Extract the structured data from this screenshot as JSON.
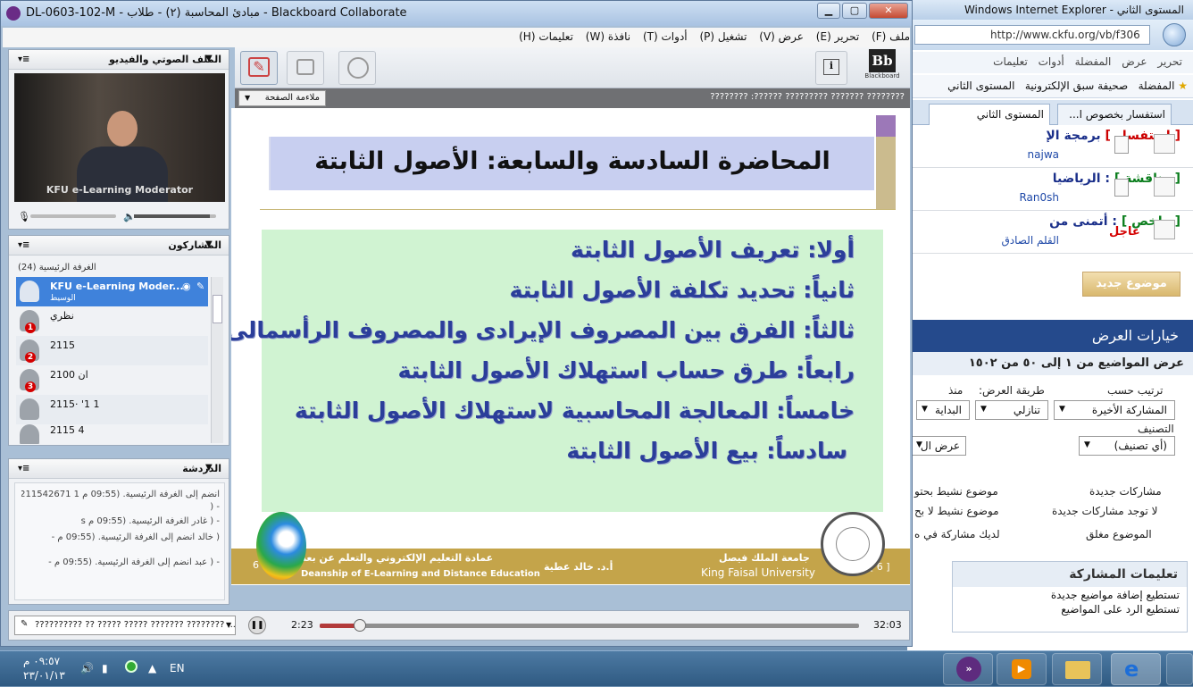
{
  "ie": {
    "title": "المستوى الثاني - Windows Internet Explorer",
    "url": "http://www.ckfu.org/vb/f306",
    "menu": [
      "تحرير",
      "عرض",
      "المفضلة",
      "أدوات",
      "تعليمات"
    ],
    "favorites": [
      "المفضلة",
      "صحيفة سبق الإلكترونية",
      "المستوى الثاني"
    ],
    "tabs": [
      "استفسار بخصوص ا...",
      "المستوى الثاني"
    ],
    "topics": [
      {
        "tag": "[ استفسار ]",
        "title": "برمجة الإ",
        "author": "najwa"
      },
      {
        "tag": "[ مناقشة ]",
        "title": ": الرياضيا",
        "author": "Ran0sh"
      },
      {
        "tag": "[ ملخص ]",
        "title": ": أتمنى من",
        "author": "القلم الصادق",
        "urgent": "عاجل"
      }
    ],
    "new_topic": "موضوع جديد",
    "display_options_title": "خيارات العرض",
    "range_text": "عرض المواضيع من ١ إلى ٥٠ من ١٥٠٢",
    "sort_by_label": "ترتيب حسب",
    "sort_method_label": "طريقة العرض:",
    "since_label": "منذ",
    "sort_by_value": "المشاركة الأخيرة",
    "sort_method_value": "تنازلي",
    "since_value": "البداية",
    "category_label": "التصنيف",
    "category_value": "(أي تصنيف)",
    "show_button": "عرض ال",
    "legend": [
      "مشاركات جديدة",
      "موضوع نشيط بحتو",
      "لا توجد مشاركات جديدة",
      "موضوع نشيط لا بح",
      "الموضوع مغلق",
      "لديك مشاركة في ه"
    ],
    "rules_title": "تعليمات المشاركة",
    "rules": [
      "تستطيع إضافة مواضيع جديدة",
      "تستطيع الرد على المواضيع"
    ]
  },
  "collab": {
    "title": "DL-0603-102-M - مبادئ المحاسبة (٢) - طلاب - Blackboard Collaborate",
    "menu": [
      "ملف (F)",
      "تحرير (E)",
      "عرض (V)",
      "تشغيل (P)",
      "أدوات (T)",
      "نافذة (W)",
      "تعليمات (H)"
    ],
    "av_panel_title": "الملف الصوتي والفيديو",
    "video_caption": "KFU e-Learning Moderator",
    "participants_title": "المشاركون",
    "room_label": "الغرفة الرئيسية",
    "room_count": "(24)",
    "participants": [
      {
        "name": "KFU e-Learning Moder...",
        "role": "الوسيط"
      },
      {
        "name": "نظري",
        "num": "1"
      },
      {
        "name": "2115",
        "num": "2"
      },
      {
        "name": "2100          ان",
        "num": "3"
      },
      {
        "name": "2115·    '1  1"
      },
      {
        "name": "2115       4"
      }
    ],
    "chat_title": "الدردشة",
    "chat": [
      "انضم إلى الغرفة الرئيسية. (09:55 م 1 211542671 -",
      "-     (",
      "- ( غادر الغرفة الرئيسية. (09:55 م    s",
      "( خالد   انضم إلى الغرفة الرئيسية. (09:55 م -",
      "- ( عبد انضم إلى الغرفة الرئيسية. (09:55 م -"
    ],
    "fit_page": "ملاءمة الصفحة",
    "wb_title": "???????? :?????? ????????? ??????? ????????",
    "blackboard_label": "Blackboard",
    "playback_text": "?????????? ?? ????? ????? ??????? ???????? ...",
    "time_current": "2:23",
    "time_total": "32:03",
    "progress": 0.074
  },
  "slide": {
    "title": "المحاضرة السادسة والسابعة: الأصول الثابتة",
    "items": [
      "أولا: تعريف الأصول الثابتة",
      "ثانياً: تحديد تكلفة الأصول الثابتة",
      "ثالثاً: الفرق بين المصروف الإيرادى والمصروف الرأسمالى",
      "رابعاً: طرق حساب استهلاك الأصول الثابتة",
      "خامساً: المعالجة المحاسبية لاستهلاك الأصول الثابتة",
      "سادساً: بيع الأصول الثابتة"
    ],
    "footer_dean_ar": "عمادة التعليم الإلكتروني والتعلم عن بعد",
    "footer_dean_en": "Deanship of E-Learning and Distance Education",
    "footer_prof": "أ.د. خالد عطية",
    "footer_uni_ar": "جامعة الملك فيصل",
    "footer_uni_en": "King Faisal University",
    "page_left": "6",
    "page_right": "[ 6 ]"
  },
  "taskbar": {
    "lang": "EN",
    "time": "٠٩:٥٧ م",
    "date": "٢٣/٠١/١٣"
  },
  "colors": {
    "accent": "#2b3e9a",
    "slide_green": "#d0f3d2",
    "footer_gold": "#c4a44a",
    "title_band": "#c8cff0"
  }
}
